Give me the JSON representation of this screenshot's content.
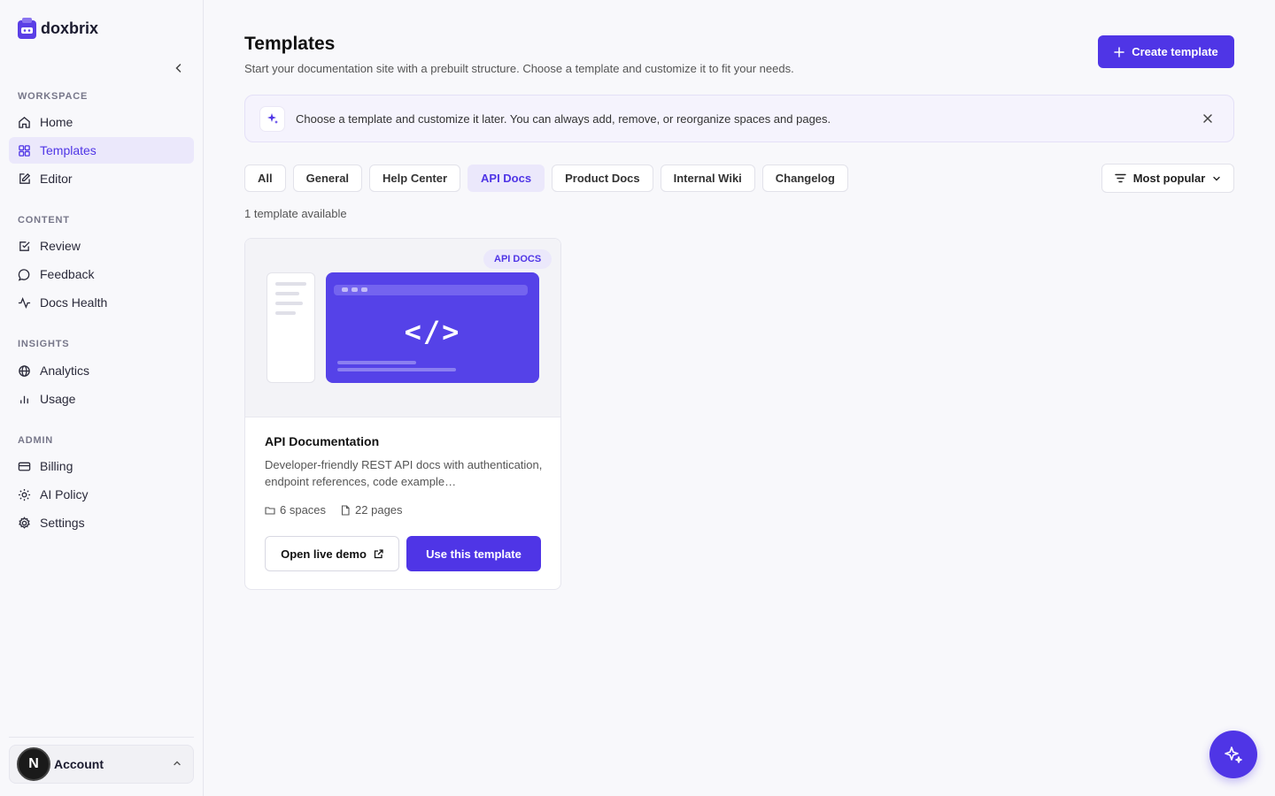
{
  "app": {
    "name": "doxbrix"
  },
  "sidebar": {
    "sections": [
      {
        "label": "WORKSPACE",
        "items": [
          {
            "label": "Home",
            "icon": "home-icon"
          },
          {
            "label": "Templates",
            "icon": "grid-icon",
            "active": true
          },
          {
            "label": "Editor",
            "icon": "edit-icon"
          }
        ]
      },
      {
        "label": "CONTENT",
        "items": [
          {
            "label": "Review",
            "icon": "check-square-icon"
          },
          {
            "label": "Feedback",
            "icon": "message-icon"
          },
          {
            "label": "Docs Health",
            "icon": "activity-icon"
          }
        ]
      },
      {
        "label": "INSIGHTS",
        "items": [
          {
            "label": "Analytics",
            "icon": "globe-icon"
          },
          {
            "label": "Usage",
            "icon": "bar-chart-icon"
          }
        ]
      },
      {
        "label": "ADMIN",
        "items": [
          {
            "label": "Billing",
            "icon": "credit-card-icon"
          },
          {
            "label": "AI Policy",
            "icon": "sun-icon"
          },
          {
            "label": "Settings",
            "icon": "gear-icon"
          }
        ]
      }
    ],
    "account": {
      "initial": "N",
      "label": "Account"
    }
  },
  "header": {
    "title": "Templates",
    "subtitle": "Start your documentation site with a prebuilt structure. Choose a template and customize it to fit your needs.",
    "create_label": "Create template"
  },
  "banner": {
    "text": "Choose a template and customize it later. You can always add, remove, or reorganize spaces and pages."
  },
  "filters": {
    "chips": [
      "All",
      "General",
      "Help Center",
      "API Docs",
      "Product Docs",
      "Internal Wiki",
      "Changelog"
    ],
    "active": "API Docs",
    "sort_label": "Most popular"
  },
  "results": {
    "count_text": "1 template available"
  },
  "template_card": {
    "badge": "API DOCS",
    "code_glyph": "</>",
    "title": "API Documentation",
    "description": "Developer-friendly REST API docs with authentication, endpoint references, code example…",
    "spaces": "6 spaces",
    "pages": "22 pages",
    "demo_label": "Open live demo",
    "use_label": "Use this template"
  },
  "colors": {
    "accent": "#4f35e6",
    "accent_soft": "#ebe8fb"
  }
}
